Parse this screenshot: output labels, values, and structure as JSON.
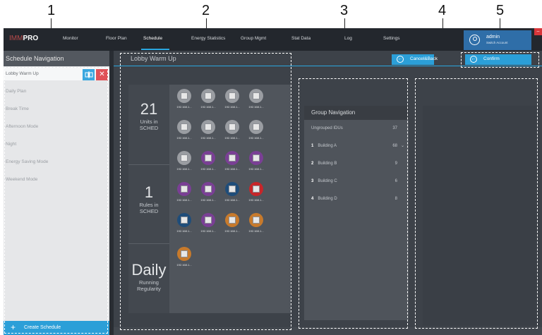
{
  "callouts": [
    "1",
    "2",
    "3",
    "4",
    "5"
  ],
  "app": {
    "logo_accent": "IMM",
    "logo_main": "PRO"
  },
  "nav": {
    "items": [
      "Monitor",
      "Floor Plan",
      "Schedule",
      "Energy Statistics",
      "Group Mgmt",
      "Stat Data",
      "Log",
      "Settings"
    ],
    "active": "Schedule"
  },
  "user": {
    "name": "admin",
    "sub": "Switch Account"
  },
  "sidebar": {
    "title": "Schedule Navigation",
    "items": [
      "Lobby Warm Up",
      "Daily Plan",
      "Break Time",
      "Afternoon Mode",
      "Night",
      "Energy Saving Mode",
      "Weekend Mode"
    ],
    "selected": "Lobby Warm Up",
    "create_label": "Create Schedule"
  },
  "main": {
    "title": "Lobby Warm Up",
    "cancel_label": "Cancel&Back",
    "confirm_label": "Confirm"
  },
  "stats": {
    "units": {
      "value": "21",
      "label1": "Units in",
      "label2": "SCHED"
    },
    "rules": {
      "value": "1",
      "label1": "Rules in",
      "label2": "SCHED"
    },
    "running": {
      "value": "Daily",
      "label1": "Running",
      "label2": "Regularity"
    }
  },
  "idus": {
    "ip_label": "192.168.1...",
    "colors": {
      "gray": "#9a9da2",
      "purple": "#7a3f95",
      "navy": "#1f4d7a",
      "red": "#c7262a",
      "orange": "#c77a2c"
    },
    "rows": [
      [
        "gray",
        "gray",
        "gray",
        "gray"
      ],
      [
        "gray",
        "gray",
        "gray",
        "gray"
      ],
      [
        "gray",
        "purple",
        "purple",
        "purple"
      ],
      [
        "purple",
        "purple",
        "navy",
        "red"
      ],
      [
        "navy",
        "purple",
        "orange",
        "orange"
      ],
      [
        "orange"
      ]
    ]
  },
  "groups": {
    "title": "Group Navigation",
    "ungrouped": {
      "label": "Ungrouped IDUs",
      "count": "37"
    },
    "buildings": [
      {
        "index": "1",
        "label": "Building A",
        "count": "68",
        "expandable": true
      },
      {
        "index": "2",
        "label": "Building B",
        "count": "9",
        "expandable": false
      },
      {
        "index": "3",
        "label": "Building C",
        "count": "6",
        "expandable": false
      },
      {
        "index": "4",
        "label": "Building D",
        "count": "8",
        "expandable": false
      }
    ]
  }
}
